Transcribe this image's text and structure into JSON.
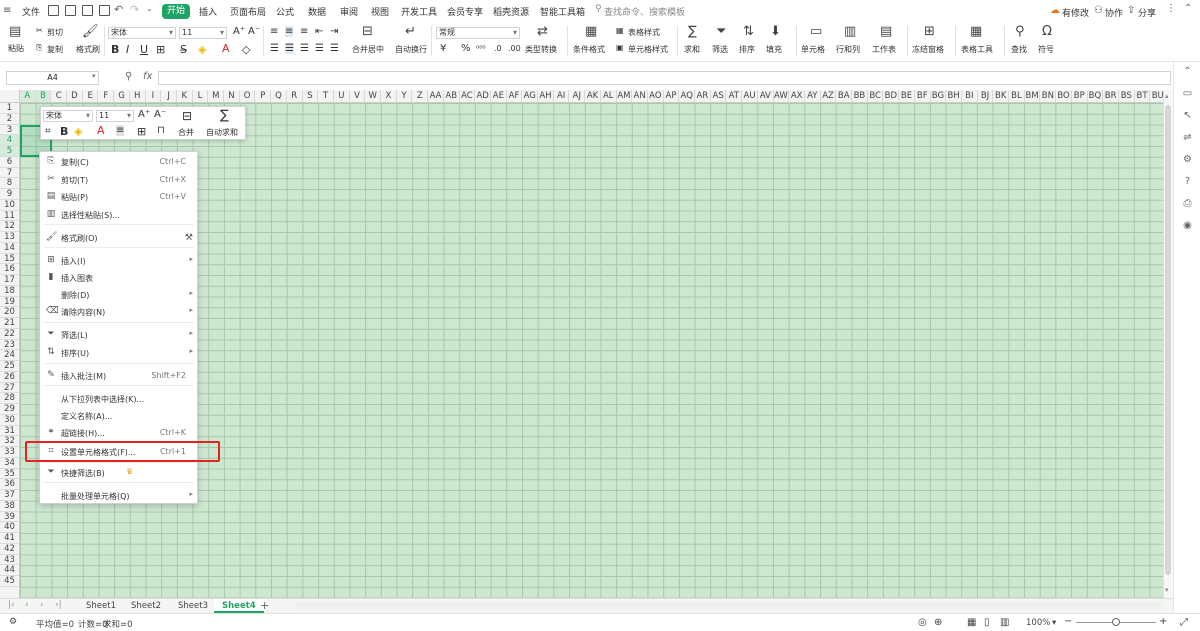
{
  "menubar": {
    "file": "文件",
    "tabs": [
      "开始",
      "插入",
      "页面布局",
      "公式",
      "数据",
      "审阅",
      "视图",
      "开发工具",
      "会员专享",
      "稻壳资源",
      "智能工具箱"
    ],
    "search_placeholder": "查找命令、搜索模板",
    "has_changes": "有修改",
    "collaborate": "协作",
    "share": "分享"
  },
  "ribbon": {
    "paste": "粘贴",
    "cut": "剪切",
    "copy": "复制",
    "format_painter": "格式刷",
    "font_name": "宋体",
    "font_size": "11",
    "merge_center": "合并居中",
    "wrap_text": "自动换行",
    "number_format": "常规",
    "type_convert": "类型转换",
    "cond_format": "条件格式",
    "table_style": "表格样式",
    "cell_style": "单元格样式",
    "sum": "求和",
    "filter": "筛选",
    "sort": "排序",
    "fill": "填充",
    "cell": "单元格",
    "row_col": "行和列",
    "worksheet": "工作表",
    "freeze": "冻结窗格",
    "table_tools": "表格工具",
    "find": "查找",
    "symbol": "符号",
    "currency": "¥",
    "percent": "%"
  },
  "formula_bar": {
    "name_box": "A4",
    "fx": "fx",
    "formula": ""
  },
  "columns": [
    "A",
    "B",
    "C",
    "D",
    "E",
    "F",
    "G",
    "H",
    "I",
    "J",
    "K",
    "L",
    "M",
    "N",
    "O",
    "P",
    "Q",
    "R",
    "S",
    "T",
    "U",
    "V",
    "W",
    "X",
    "Y",
    "Z",
    "AA",
    "AB",
    "AC",
    "AD",
    "AE",
    "AF",
    "AG",
    "AH",
    "AI",
    "AJ",
    "AK",
    "AL",
    "AM",
    "AN",
    "AO",
    "AP",
    "AQ",
    "AR",
    "AS",
    "AT",
    "AU",
    "AV",
    "AW",
    "AX",
    "AY",
    "AZ",
    "BA",
    "BB",
    "BC",
    "BD",
    "BE",
    "BF",
    "BG",
    "BH",
    "BI",
    "BJ",
    "BK",
    "BL",
    "BM",
    "BN",
    "BO",
    "BP",
    "BQ",
    "BR",
    "BS",
    "BT",
    "BU"
  ],
  "rows": [
    "1",
    "2",
    "3",
    "4",
    "5",
    "6",
    "7",
    "8",
    "9",
    "10",
    "11",
    "12",
    "13",
    "14",
    "15",
    "16",
    "17",
    "18",
    "19",
    "20",
    "21",
    "22",
    "23",
    "24",
    "25",
    "26",
    "27",
    "28",
    "29",
    "30",
    "31",
    "32",
    "33",
    "34",
    "35",
    "36",
    "37",
    "38",
    "39",
    "40",
    "41",
    "42",
    "43",
    "44",
    "45"
  ],
  "mini_toolbar": {
    "font_name": "宋体",
    "font_size": "11",
    "merge": "合并",
    "autosum": "自动求和"
  },
  "context_menu": {
    "items": [
      {
        "label": "复制(C)",
        "shortcut": "Ctrl+C",
        "icon": "copy-icon"
      },
      {
        "label": "剪切(T)",
        "shortcut": "Ctrl+X",
        "icon": "scissors-icon"
      },
      {
        "label": "粘贴(P)",
        "shortcut": "Ctrl+V",
        "icon": "paste-icon"
      },
      {
        "label": "选择性粘贴(S)...",
        "shortcut": "",
        "icon": "paste-special-icon"
      },
      {
        "label": "格式刷(O)",
        "shortcut": "",
        "icon": "format-painter-icon"
      },
      {
        "label": "插入(I)",
        "shortcut": "",
        "icon": "insert-icon"
      },
      {
        "label": "插入图表",
        "shortcut": "",
        "icon": "chart-icon"
      },
      {
        "label": "删除(D)",
        "shortcut": "",
        "icon": ""
      },
      {
        "label": "清除内容(N)",
        "shortcut": "",
        "icon": "eraser-icon"
      },
      {
        "label": "筛选(L)",
        "shortcut": "",
        "icon": "filter-icon"
      },
      {
        "label": "排序(U)",
        "shortcut": "",
        "icon": "sort-icon"
      },
      {
        "label": "插入批注(M)",
        "shortcut": "Shift+F2",
        "icon": "comment-icon"
      },
      {
        "label": "从下拉列表中选择(K)...",
        "shortcut": "",
        "icon": ""
      },
      {
        "label": "定义名称(A)...",
        "shortcut": "",
        "icon": ""
      },
      {
        "label": "超链接(H)...",
        "shortcut": "Ctrl+K",
        "icon": "link-icon"
      },
      {
        "label": "设置单元格格式(F)...",
        "shortcut": "Ctrl+1",
        "icon": "format-cells-icon"
      },
      {
        "label": "快捷筛选(B)",
        "shortcut": "",
        "icon": "quick-filter-icon"
      },
      {
        "label": "批量处理单元格(Q)",
        "shortcut": "",
        "icon": ""
      }
    ]
  },
  "sheets": [
    "Sheet1",
    "Sheet2",
    "Sheet3",
    "Sheet4"
  ],
  "active_sheet": "Sheet4",
  "status": {
    "average": "平均值=0",
    "count": "计数=0",
    "sum": "求和=0",
    "zoom": "100%"
  },
  "colors": {
    "accent": "#1fa364",
    "grid_bg": "#cde7d0",
    "highlight": "#e02424"
  }
}
